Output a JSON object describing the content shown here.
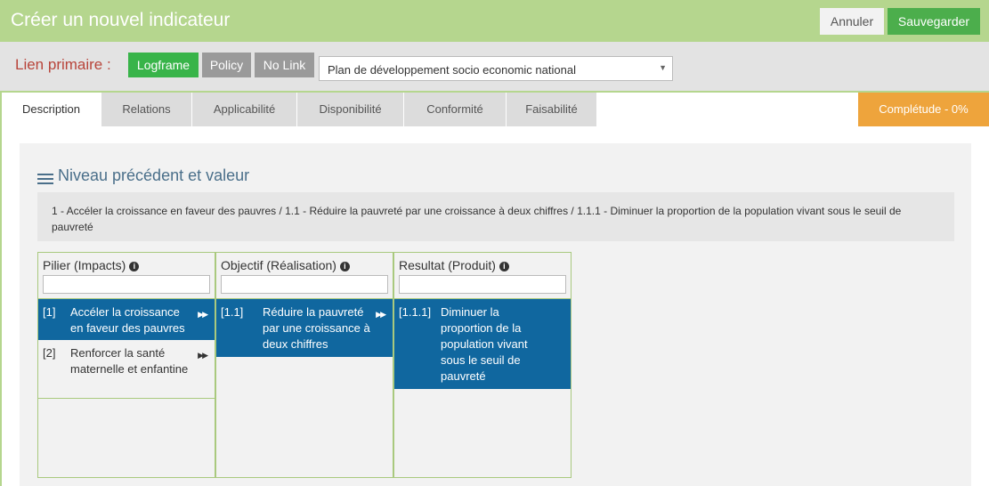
{
  "header": {
    "title": "Créer un nouvel indicateur",
    "cancel_label": "Annuler",
    "save_label": "Sauvegarder"
  },
  "link_bar": {
    "label": "Lien primaire :",
    "options": [
      "Logframe",
      "Policy",
      "No Link"
    ],
    "selected_option": "Logframe",
    "plan_select_value": "Plan de développement socio economic national"
  },
  "tabs": [
    "Description",
    "Relations",
    "Applicabilité",
    "Disponibilité",
    "Conformité",
    "Faisabilité"
  ],
  "active_tab": "Description",
  "completeness": "Complétude  - 0%",
  "section": {
    "title": "Niveau précédent et valeur",
    "breadcrumb": "1 - Accéler la croissance en faveur des pauvres   /   1.1 - Réduire la pauvreté par une croissance à deux chiffres   /   1.1.1 - Diminuer la proportion de la population vivant sous le seuil de pauvreté"
  },
  "columns": [
    {
      "title": "Pilier (Impacts)",
      "items": [
        {
          "code": "[1]",
          "label": "Accéler la croissance en faveur des pauvres",
          "selected": true
        },
        {
          "code": "[2]",
          "label": "Renforcer la santé maternelle et enfantine",
          "selected": false
        }
      ]
    },
    {
      "title": "Objectif (Réalisation)",
      "items": [
        {
          "code": "[1.1]",
          "label": "Réduire la pauvreté par une croissance à deux chiffres",
          "selected": true
        }
      ]
    },
    {
      "title": "Resultat (Produit)",
      "items": [
        {
          "code": "[1.1.1]",
          "label": "Diminuer la proportion de la population vivant sous le seuil de pauvreté",
          "selected": true
        }
      ]
    }
  ],
  "colors": {
    "header_green": "#b5d68e",
    "save_green": "#4cae4c",
    "logframe_green": "#38b449",
    "selected_blue": "#10679f",
    "completeness_orange": "#eea43c",
    "lien_red": "#b8453b"
  }
}
